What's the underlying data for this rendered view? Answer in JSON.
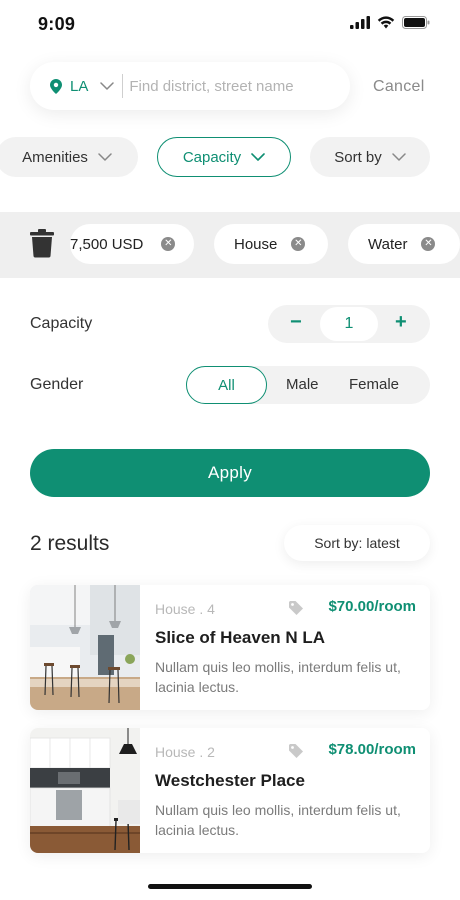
{
  "status_bar": {
    "time": "9:09"
  },
  "search": {
    "location": "LA",
    "placeholder": "Find district, street name",
    "cancel_label": "Cancel"
  },
  "filter_chips": [
    {
      "label": "Amenities",
      "active": false
    },
    {
      "label": "Capacity",
      "active": true
    },
    {
      "label": "Sort by",
      "active": false
    }
  ],
  "applied_filters": [
    "7,500 USD",
    "House",
    "Water"
  ],
  "capacity": {
    "label": "Capacity",
    "minus": "−",
    "value": "1",
    "plus": "+"
  },
  "gender": {
    "label": "Gender",
    "options": [
      "All",
      "Male",
      "Female"
    ],
    "selected": "All"
  },
  "apply_label": "Apply",
  "results": {
    "count_text": "2 results",
    "sort_label": "Sort by: latest"
  },
  "listings": [
    {
      "type": "House . 4",
      "price": "$70.00/room",
      "title": "Slice of Heaven N LA",
      "description": "Nullam quis leo mollis, interdum felis ut, lacinia lectus."
    },
    {
      "type": "House . 2",
      "price": "$78.00/room",
      "title": "Westchester Place",
      "description": "Nullam quis leo mollis, interdum felis ut, lacinia lectus."
    }
  ],
  "colors": {
    "accent": "#0f8f73",
    "chip_bg": "#f2f2f2",
    "band_bg": "#efefef"
  }
}
